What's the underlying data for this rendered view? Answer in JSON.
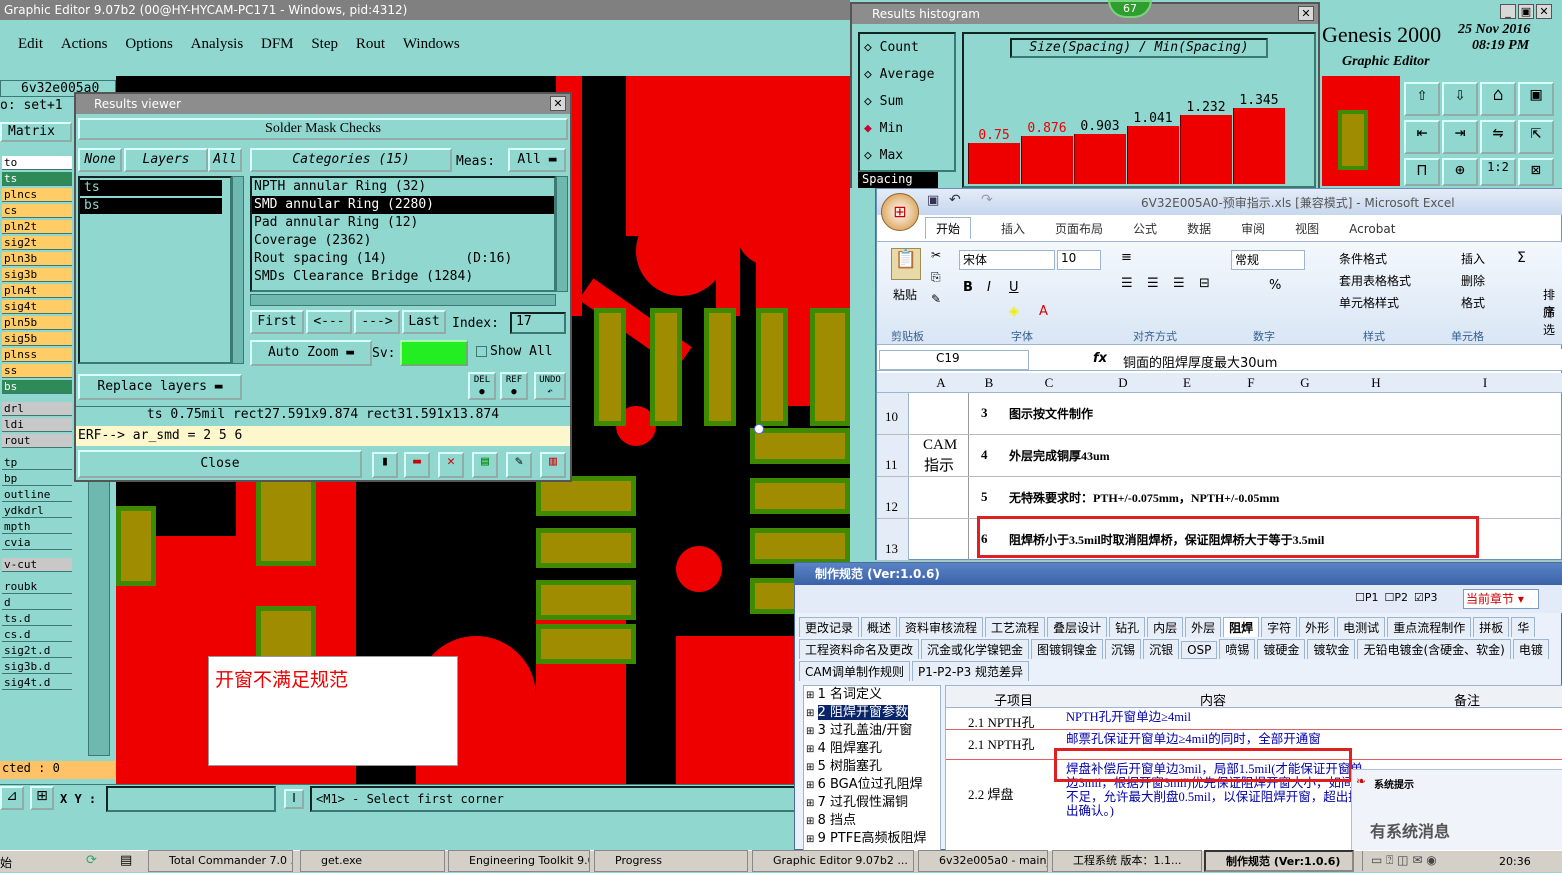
{
  "genesis": {
    "title": "Graphic Editor 9.07b2 (00@HY-HYCAM-PC171 - Windows, pid:4312)",
    "menu": [
      "Edit",
      "Actions",
      "Options",
      "Analysis",
      "DFM",
      "Step",
      "Rout",
      "Windows"
    ],
    "job": "6v32e005a0",
    "set_line": "o: set+1",
    "matrix_label": "Matrix",
    "layers": [
      "to",
      "ts",
      "plncs",
      "cs",
      "pln2t",
      "sig2t",
      "pln3b",
      "sig3b",
      "pln4t",
      "sig4t",
      "pln5b",
      "sig5b",
      "plnss",
      "ss",
      "bs",
      "drl",
      "ldi",
      "rout",
      "tp",
      "bp",
      "outline",
      "ydkdrl",
      "mpth",
      "cvia",
      "v-cut",
      "roubk",
      "d",
      "ts.d",
      "cs.d",
      "sig2t.d",
      "sig3b.d",
      "sig4t.d"
    ],
    "selected_count": "cted : 0",
    "xy_label": "X Y :",
    "status_msg": "<M1> - Select first corner",
    "brand": "Genesis 2000",
    "brand_sub": "Graphic Editor",
    "date": "25 Nov 2016",
    "time": "08:19 PM",
    "annotation": "开窗不满足规范",
    "badge": "67"
  },
  "results_viewer": {
    "title": "Results viewer",
    "header": "Solder Mask Checks",
    "none_btn": "None",
    "layers_btn": "Layers",
    "all_btn": "All",
    "categories_btn": "Categories (15)",
    "meas_label": "Meas:",
    "meas_value": "All",
    "layer_items": [
      "ts",
      "bs"
    ],
    "categories": [
      {
        "label": "NPTH annular Ring (32)"
      },
      {
        "label": "SMD annular Ring (2280)"
      },
      {
        "label": "Pad annular Ring (12)"
      },
      {
        "label": "Coverage (2362)"
      },
      {
        "label": "Rout spacing (14)          (D:16)"
      },
      {
        "label": "SMDs Clearance Bridge (1284)"
      }
    ],
    "first": "First",
    "prev": "<---",
    "next": "--->",
    "last": "Last",
    "index_label": "Index:",
    "index_value": "17",
    "auto_zoom": "Auto Zoom",
    "sv_label": "Sv:",
    "show_all": "Show All",
    "replace_layers": "Replace layers",
    "del": "DEL",
    "ref": "REF",
    "undo": "UNDO",
    "info_line": "ts 0.75mil  rect27.591x9.874  rect31.591x13.874",
    "erf_line": "ERF--> ar_smd = 2 5 6",
    "close": "Close"
  },
  "histogram": {
    "title": "Results histogram",
    "options": [
      "Count",
      "Average",
      "Sum",
      "Min",
      "Max"
    ],
    "selected_option": "Min",
    "spacing_label": "Spacing",
    "axis_title": "Size(Spacing) / Min(Spacing)",
    "chart_data": {
      "type": "bar",
      "values": [
        0.75,
        0.876,
        0.903,
        1.041,
        1.232,
        1.345
      ],
      "labels": [
        "0.75",
        "0.876",
        "0.903",
        "1.041",
        "1.232",
        "1.345"
      ]
    }
  },
  "excel": {
    "title": "6V32E005A0-预审指示.xls [兼容模式] - Microsoft Excel",
    "tabs": [
      "开始",
      "插入",
      "页面布局",
      "公式",
      "数据",
      "审阅",
      "视图",
      "Acrobat"
    ],
    "active_tab": "开始",
    "paste": "粘贴",
    "clipboard": "剪贴板",
    "font_name": "宋体",
    "font_size": "10",
    "font_group": "字体",
    "align_group": "对齐方式",
    "number_format": "常规",
    "number_group": "数字",
    "cond_format": "条件格式",
    "table_format": "套用表格格式",
    "cell_style": "单元格样式",
    "style_group": "样式",
    "insert": "插入",
    "delete": "删除",
    "format": "格式",
    "cells_group": "单元格",
    "sort": "排序",
    "filter": "筛选",
    "cell_ref": "C19",
    "formula": "铜面的阻焊厚度最大30um",
    "columns": [
      "A",
      "B",
      "C",
      "D",
      "E",
      "F",
      "G",
      "H",
      "I"
    ],
    "section_label": "CAM指示",
    "rows": [
      {
        "num": "10",
        "idx": "3",
        "text": "图示按文件制作"
      },
      {
        "num": "11",
        "idx": "4",
        "text": "外层完成铜厚43um"
      },
      {
        "num": "12",
        "idx": "5",
        "text": "无特殊要求时：PTH+/-0.075mm，NPTH+/-0.05mm"
      },
      {
        "num": "13",
        "idx": "6",
        "text": "阻焊桥小于3.5mil时取消阻焊桥，保证阻焊桥大于等于3.5mil"
      }
    ]
  },
  "spec": {
    "title": "制作规范 (Ver:1.0.6)",
    "checks": [
      "P1",
      "P2",
      "P3"
    ],
    "chapter": "当前章节",
    "tabs_row1": [
      "更改记录",
      "概述",
      "资料审核流程",
      "工艺流程",
      "叠层设计",
      "钻孔",
      "内层",
      "外层",
      "阻焊",
      "字符",
      "外形",
      "电测试",
      "重点流程制作",
      "拼板",
      "华"
    ],
    "active_tab": "阻焊",
    "tabs_row2": [
      "工程资料命名及更改",
      "沉金或化学镍钯金",
      "图镀铜镍金",
      "沉锡",
      "沉银",
      "OSP",
      "喷锡",
      "镀硬金",
      "镀软金",
      "无铅电镀金(含硬金、软金)",
      "电镀"
    ],
    "tabs_row3": [
      "CAM调单制作规则",
      "P1-P2-P3 规范差异"
    ],
    "tree": [
      "1 名词定义",
      "2 阻焊开窗参数",
      "3 过孔盖油/开窗",
      "4 阻焊塞孔",
      "5 树脂塞孔",
      "6 BGA位过孔阻焊",
      "7 过孔假性漏铜",
      "8 挡点",
      "9 PTFE高频板阻焊"
    ],
    "selected_tree": "2 阻焊开窗参数",
    "col_sub": "子项目",
    "col_content": "内容",
    "col_note": "备注",
    "rows": [
      {
        "sub": "2.1 NPTH孔",
        "content": "NPTH孔开窗单边≥4mil"
      },
      {
        "sub": "2.1 NPTH孔",
        "content": "邮票孔保证开窗单边≥4mil的同时，全部开通窗"
      },
      {
        "sub": "2.2 焊盘",
        "content": "焊盘补偿后开窗单边3mil，局部1.5mil(才能保证开窗单边3mil，根据开窗3mil)优先保证阻焊开窗大小，如间距不足，允许最大削盘0.5mil，以保证阻焊开窗，超出提出确认。)"
      }
    ],
    "popup_title": "系统提示",
    "popup_text": "有系统消息"
  },
  "taskbar": {
    "items": [
      "Total Commander 7.0 ...",
      "get.exe",
      "Engineering Toolkit 9.0...",
      "Progress",
      "Graphic Editor 9.07b2 ...",
      "6v32e005a0 - main_qa",
      "工程系统  版本：1.1...",
      "制作规范 (Ver:1.0.6)"
    ],
    "clock": "20:36",
    "start": "始"
  }
}
